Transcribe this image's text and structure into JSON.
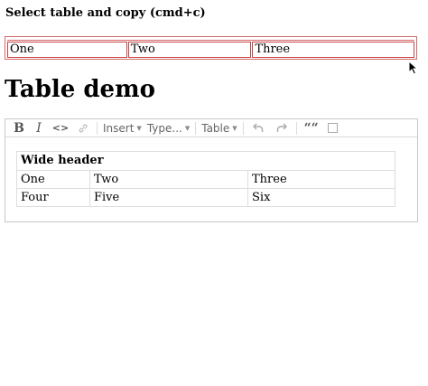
{
  "instruction": "Select table and copy (cmd+c)",
  "selected_table": {
    "cells": [
      "One",
      "Two",
      "Three"
    ]
  },
  "heading": "Table demo",
  "toolbar": {
    "bold": "B",
    "italic": "I",
    "code": "<>",
    "insert": "Insert",
    "type": "Type...",
    "table": "Table",
    "quote": "““",
    "icons": [
      "bold-icon",
      "italic-icon",
      "code-icon",
      "link-icon",
      "undo-icon",
      "redo-icon",
      "quote-icon",
      "checkbox-icon"
    ]
  },
  "editor_table": {
    "header": "Wide header",
    "rows": [
      [
        "One",
        "Two",
        "Three"
      ],
      [
        "Four",
        "Five",
        "Six"
      ]
    ]
  }
}
